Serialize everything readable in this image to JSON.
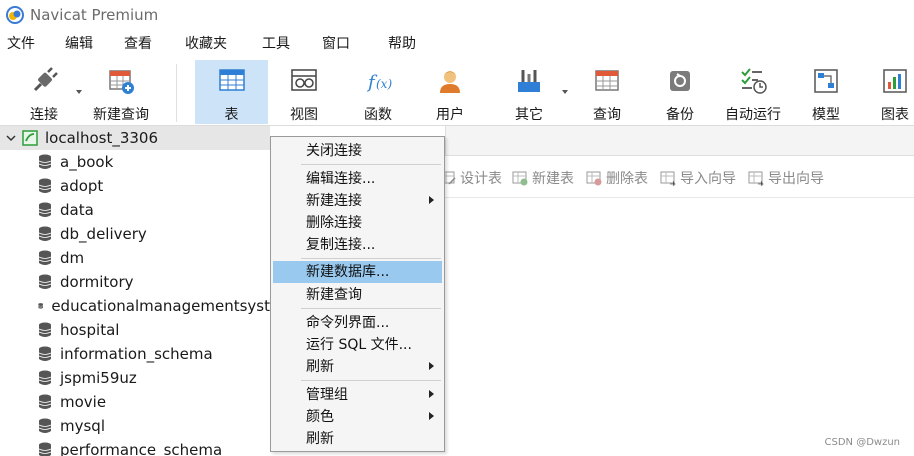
{
  "app": {
    "title": "Navicat Premium"
  },
  "menu": [
    "文件",
    "编辑",
    "查看",
    "收藏夹",
    "工具",
    "窗口",
    "帮助"
  ],
  "toolbar": {
    "connect": "连接",
    "new_query": "新建查询",
    "table": "表",
    "view": "视图",
    "function": "函数",
    "user": "用户",
    "other": "其它",
    "query": "查询",
    "backup": "备份",
    "automation": "自动运行",
    "model": "模型",
    "chart": "图表"
  },
  "tree": {
    "connection": "localhost_3306",
    "databases": [
      "a_book",
      "adopt",
      "data",
      "db_delivery",
      "dm",
      "dormitory",
      "educationalmanagementsyst",
      "hospital",
      "information_schema",
      "jspmi59uz",
      "movie",
      "mysql",
      "performance_schema"
    ]
  },
  "subtoolbar": {
    "design_table": "设计表",
    "new_table": "新建表",
    "delete_table": "删除表",
    "import_wizard": "导入向导",
    "export_wizard": "导出向导"
  },
  "context_menu": {
    "close_connection": "关闭连接",
    "edit_connection": "编辑连接...",
    "new_connection": "新建连接",
    "delete_connection": "删除连接",
    "copy_connection": "复制连接...",
    "new_database": "新建数据库...",
    "new_query": "新建查询",
    "command_line": "命令列界面...",
    "run_sql_file": "运行 SQL 文件...",
    "refresh": "刷新",
    "manage_group": "管理组",
    "color": "颜色",
    "refresh2": "刷新"
  },
  "watermark": "CSDN @Dwzun",
  "colors": {
    "active_toolbar": "#cde3f7",
    "menu_highlight": "#99c9ef",
    "connection_green": "#2e9e3a"
  }
}
